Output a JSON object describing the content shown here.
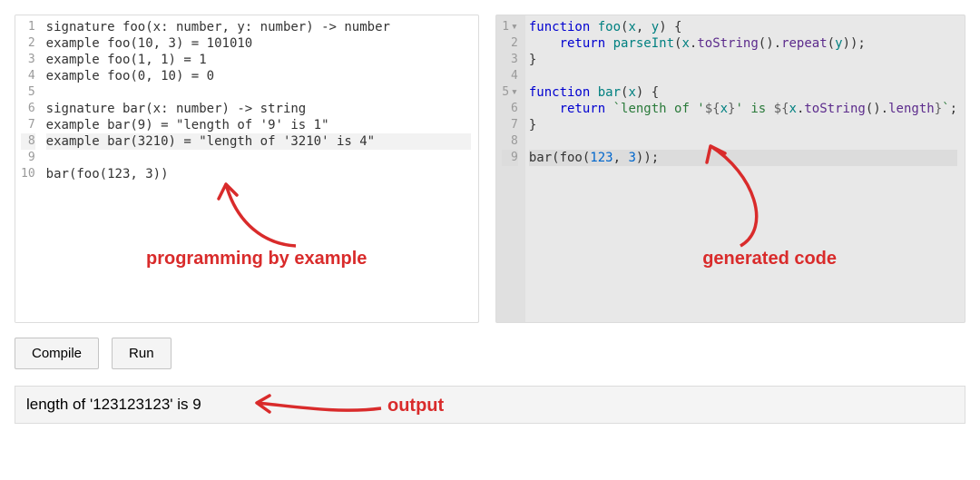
{
  "left_editor": {
    "highlighted_line": 8,
    "lines": [
      [
        {
          "t": "pl",
          "v": "signature foo(x: number, y: number) -> number"
        }
      ],
      [
        {
          "t": "pl",
          "v": "example foo(10, 3) = 101010"
        }
      ],
      [
        {
          "t": "pl",
          "v": "example foo(1, 1) = 1"
        }
      ],
      [
        {
          "t": "pl",
          "v": "example foo(0, 10) = 0"
        }
      ],
      [],
      [
        {
          "t": "pl",
          "v": "signature bar(x: number) -> string"
        }
      ],
      [
        {
          "t": "pl",
          "v": "example bar(9) = \"length of '9' is 1\""
        }
      ],
      [
        {
          "t": "pl",
          "v": "example bar(3210) = \"length of '3210' is 4\""
        }
      ],
      [],
      [
        {
          "t": "pl",
          "v": "bar(foo(123, 3))"
        }
      ]
    ]
  },
  "right_editor": {
    "highlighted_line": 9,
    "fold_lines": [
      1,
      5
    ],
    "lines": [
      [
        {
          "t": "kw",
          "v": "function"
        },
        {
          "t": "pl",
          "v": " "
        },
        {
          "t": "def",
          "v": "foo"
        },
        {
          "t": "pl",
          "v": "("
        },
        {
          "t": "var",
          "v": "x"
        },
        {
          "t": "pl",
          "v": ", "
        },
        {
          "t": "var",
          "v": "y"
        },
        {
          "t": "pl",
          "v": ") {"
        }
      ],
      [
        {
          "t": "pl",
          "v": "    "
        },
        {
          "t": "kw",
          "v": "return"
        },
        {
          "t": "pl",
          "v": " "
        },
        {
          "t": "def",
          "v": "parseInt"
        },
        {
          "t": "pl",
          "v": "("
        },
        {
          "t": "var",
          "v": "x"
        },
        {
          "t": "pl",
          "v": "."
        },
        {
          "t": "prop",
          "v": "toString"
        },
        {
          "t": "pl",
          "v": "()."
        },
        {
          "t": "prop",
          "v": "repeat"
        },
        {
          "t": "pl",
          "v": "("
        },
        {
          "t": "var",
          "v": "y"
        },
        {
          "t": "pl",
          "v": "));"
        }
      ],
      [
        {
          "t": "pl",
          "v": "}"
        }
      ],
      [],
      [
        {
          "t": "kw",
          "v": "function"
        },
        {
          "t": "pl",
          "v": " "
        },
        {
          "t": "def",
          "v": "bar"
        },
        {
          "t": "pl",
          "v": "("
        },
        {
          "t": "var",
          "v": "x"
        },
        {
          "t": "pl",
          "v": ") {"
        }
      ],
      [
        {
          "t": "pl",
          "v": "    "
        },
        {
          "t": "kw",
          "v": "return"
        },
        {
          "t": "pl",
          "v": " "
        },
        {
          "t": "tmpl",
          "v": "`length of '"
        },
        {
          "t": "op",
          "v": "${"
        },
        {
          "t": "var",
          "v": "x"
        },
        {
          "t": "op",
          "v": "}"
        },
        {
          "t": "tmpl",
          "v": "' is "
        },
        {
          "t": "op",
          "v": "${"
        },
        {
          "t": "var",
          "v": "x"
        },
        {
          "t": "pl",
          "v": "."
        },
        {
          "t": "prop",
          "v": "toString"
        },
        {
          "t": "pl",
          "v": "()."
        },
        {
          "t": "prop",
          "v": "length"
        },
        {
          "t": "op",
          "v": "}"
        },
        {
          "t": "tmpl",
          "v": "`"
        },
        {
          "t": "pl",
          "v": ";"
        }
      ],
      [
        {
          "t": "pl",
          "v": "}"
        }
      ],
      [],
      [
        {
          "t": "pl",
          "v": "bar(foo("
        },
        {
          "t": "num",
          "v": "123"
        },
        {
          "t": "pl",
          "v": ", "
        },
        {
          "t": "num",
          "v": "3"
        },
        {
          "t": "pl",
          "v": "));"
        }
      ]
    ]
  },
  "buttons": {
    "compile": "Compile",
    "run": "Run"
  },
  "output": {
    "text": "length of '123123123' is 9"
  },
  "annotations": {
    "left": "programming by example",
    "right": "generated code",
    "output": "output"
  },
  "colors": {
    "annotation": "#d92b2b"
  }
}
